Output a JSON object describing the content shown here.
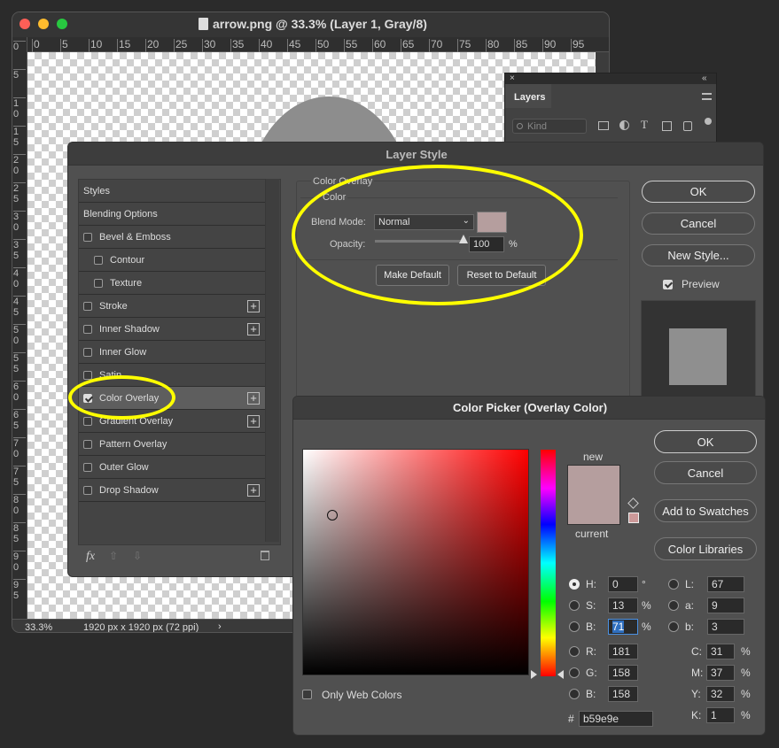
{
  "doc": {
    "title": "arrow.png @ 33.3% (Layer 1, Gray/8)",
    "ruler_top": [
      "0",
      "5",
      "10",
      "15",
      "20",
      "25",
      "30",
      "35",
      "40",
      "45",
      "50",
      "55",
      "60",
      "65",
      "70",
      "75",
      "80",
      "85",
      "90",
      "95"
    ],
    "ruler_left": [
      "0",
      "5",
      "1\n0",
      "1\n5",
      "2\n0",
      "2\n5",
      "3\n0",
      "3\n5",
      "4\n0",
      "4\n5",
      "5\n0",
      "5\n5",
      "6\n0",
      "6\n5",
      "7\n0",
      "7\n5",
      "8\n0",
      "8\n5",
      "9\n0",
      "9\n5"
    ],
    "zoom": "33.3%",
    "size": "1920 px x 1920 px (72 ppi)"
  },
  "layers": {
    "title": "Layers",
    "kind": "Kind"
  },
  "ls": {
    "title": "Layer Style",
    "items": [
      {
        "label": "Styles",
        "cb": null,
        "plus": false,
        "indent": 0
      },
      {
        "label": "Blending Options",
        "cb": null,
        "plus": false,
        "indent": 0
      },
      {
        "label": "Bevel & Emboss",
        "cb": false,
        "plus": false,
        "indent": 0
      },
      {
        "label": "Contour",
        "cb": false,
        "plus": false,
        "indent": 1
      },
      {
        "label": "Texture",
        "cb": false,
        "plus": false,
        "indent": 1
      },
      {
        "label": "Stroke",
        "cb": false,
        "plus": true,
        "indent": 0
      },
      {
        "label": "Inner Shadow",
        "cb": false,
        "plus": true,
        "indent": 0
      },
      {
        "label": "Inner Glow",
        "cb": false,
        "plus": false,
        "indent": 0
      },
      {
        "label": "Satin",
        "cb": false,
        "plus": false,
        "indent": 0
      },
      {
        "label": "Color Overlay",
        "cb": true,
        "plus": true,
        "indent": 0
      },
      {
        "label": "Gradient Overlay",
        "cb": false,
        "plus": true,
        "indent": 0
      },
      {
        "label": "Pattern Overlay",
        "cb": false,
        "plus": false,
        "indent": 0
      },
      {
        "label": "Outer Glow",
        "cb": false,
        "plus": false,
        "indent": 0
      },
      {
        "label": "Drop Shadow",
        "cb": false,
        "plus": true,
        "indent": 0
      }
    ],
    "section": "Color Overlay",
    "group": "Color",
    "blend_label": "Blend Mode:",
    "blend": "Normal",
    "opacity_label": "Opacity:",
    "opacity": "100",
    "opacity_value": 100,
    "pct": "%",
    "make_default": "Make Default",
    "reset_default": "Reset to Default",
    "ok": "OK",
    "cancel": "Cancel",
    "new_style": "New Style...",
    "preview": "Preview",
    "fx": "fx"
  },
  "cp": {
    "title": "Color Picker (Overlay Color)",
    "ok": "OK",
    "cancel": "Cancel",
    "add": "Add to Swatches",
    "libraries": "Color Libraries",
    "new": "new",
    "current": "current",
    "only_web": "Only Web Colors",
    "hsb": [
      {
        "l": "H:",
        "v": "0",
        "u": "°",
        "on": true
      },
      {
        "l": "S:",
        "v": "13",
        "u": "%",
        "on": false
      },
      {
        "l": "B:",
        "v": "71",
        "u": "%",
        "on": false
      }
    ],
    "rgb": [
      {
        "l": "R:",
        "v": "181"
      },
      {
        "l": "G:",
        "v": "158"
      },
      {
        "l": "B:",
        "v": "158"
      }
    ],
    "lab": [
      {
        "l": "L:",
        "v": "67"
      },
      {
        "l": "a:",
        "v": "9"
      },
      {
        "l": "b:",
        "v": "3"
      }
    ],
    "cmyk": [
      {
        "l": "C:",
        "v": "31",
        "u": "%"
      },
      {
        "l": "M:",
        "v": "37",
        "u": "%"
      },
      {
        "l": "Y:",
        "v": "32",
        "u": "%"
      },
      {
        "l": "K:",
        "v": "1",
        "u": "%"
      }
    ],
    "hash": "#",
    "hex": "b59e9e"
  },
  "colors": {
    "swatch": "#b59e9e",
    "hue": "#ff0000",
    "highlight": "#ffff00"
  }
}
